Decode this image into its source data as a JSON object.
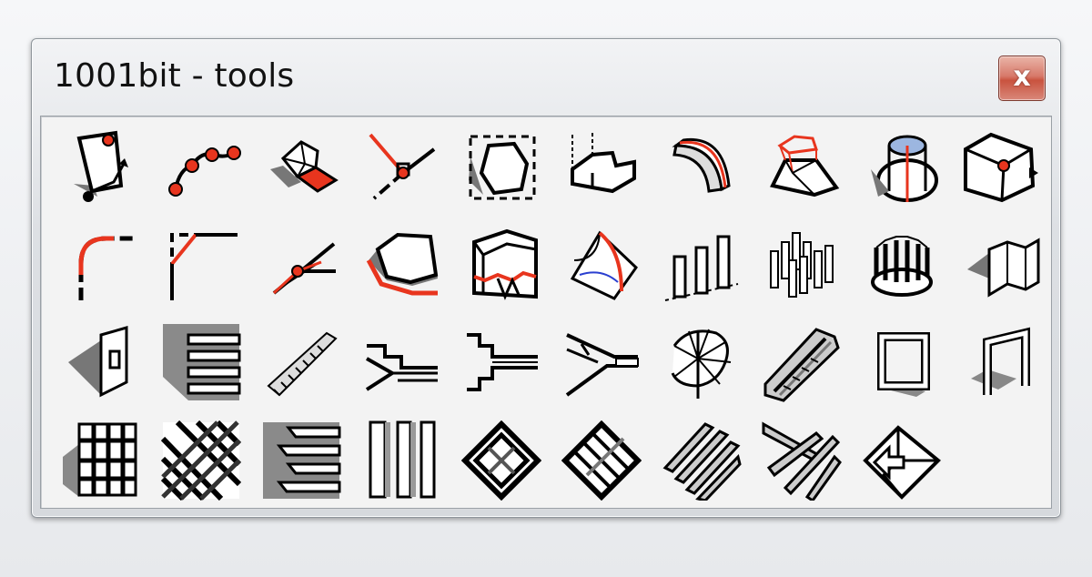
{
  "window": {
    "title": "1001bit - tools",
    "close_label": "x"
  },
  "colors": {
    "accent_red": "#e8351e",
    "ink": "#000000",
    "shadow": "#6f6f6f"
  },
  "tools": [
    {
      "icon": "rectangle-points-icon"
    },
    {
      "icon": "polyline-points-icon"
    },
    {
      "icon": "faceted-solid-icon"
    },
    {
      "icon": "line-intersection-icon"
    },
    {
      "icon": "offset-outline-icon"
    },
    {
      "icon": "extruded-profile-icon"
    },
    {
      "icon": "curved-extrusion-icon"
    },
    {
      "icon": "frustum-top-face-icon"
    },
    {
      "icon": "hole-cutter-icon"
    },
    {
      "icon": "cube-point-icon"
    },
    {
      "icon": "fillet-corner-icon"
    },
    {
      "icon": "chamfer-corner-icon"
    },
    {
      "icon": "angle-bisector-icon"
    },
    {
      "icon": "edge-offset-icon"
    },
    {
      "icon": "wall-section-icon"
    },
    {
      "icon": "curved-surface-icon"
    },
    {
      "icon": "pillars-row-icon"
    },
    {
      "icon": "pillars-grid-icon"
    },
    {
      "icon": "pillars-circle-icon"
    },
    {
      "icon": "folded-wall-icon"
    },
    {
      "icon": "wall-opening-icon"
    },
    {
      "icon": "stacked-slabs-icon"
    },
    {
      "icon": "straight-stair-icon"
    },
    {
      "icon": "stair-profile-icon"
    },
    {
      "icon": "stair-landing-icon"
    },
    {
      "icon": "stair-section-icon"
    },
    {
      "icon": "spiral-stair-icon"
    },
    {
      "icon": "ramp-stair-icon"
    },
    {
      "icon": "window-frame-icon"
    },
    {
      "icon": "door-frame-icon"
    },
    {
      "icon": "grid-frame-icon"
    },
    {
      "icon": "lattice-icon"
    },
    {
      "icon": "stepped-slabs-icon"
    },
    {
      "icon": "vertical-fins-icon"
    },
    {
      "icon": "roof-frame-icon"
    },
    {
      "icon": "roof-rafters-icon"
    },
    {
      "icon": "parallel-beams-icon"
    },
    {
      "icon": "radial-beams-icon"
    },
    {
      "icon": "folded-arrow-icon"
    }
  ]
}
